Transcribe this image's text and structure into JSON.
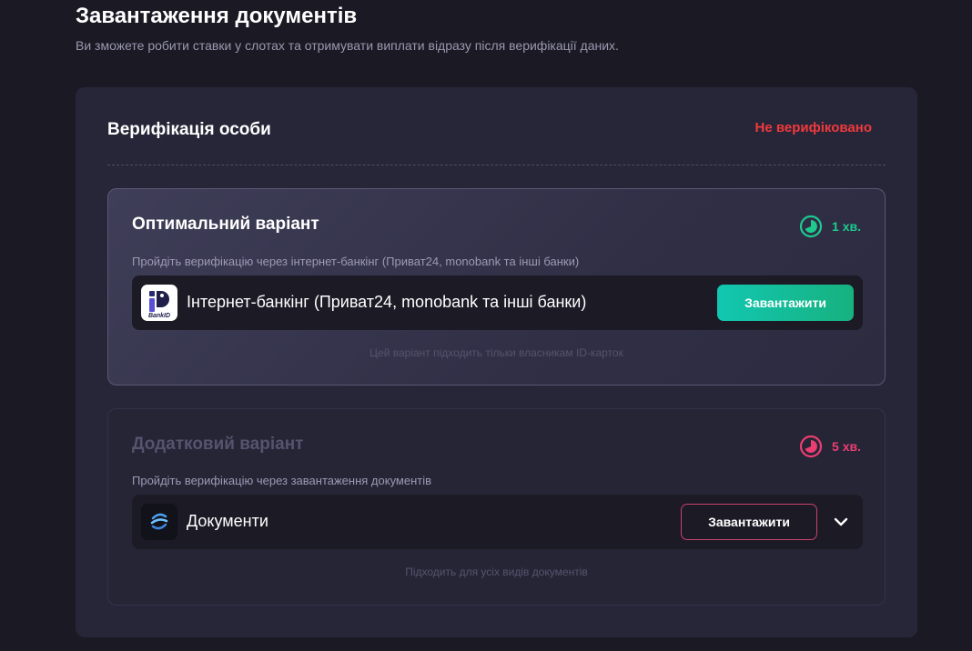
{
  "header": {
    "title": "Завантаження документів",
    "subtitle": "Ви зможете робити ставки у слотах та отримувати виплати відразу після верифікації даних."
  },
  "verification": {
    "title": "Верифікація особи",
    "status": "Не верифіковано",
    "status_color": "#f0393d"
  },
  "options": [
    {
      "title": "Оптимальний варіант",
      "time": "1 хв.",
      "time_color": "#1ec98e",
      "description": "Пройдіть верифікацію через інтернет-банкінг (Приват24, monobank та інші банки)",
      "method_label": "Інтернет-банкінг (Приват24, monobank та інші банки)",
      "icon": "bankid-logo-icon",
      "icon_text": "BankID",
      "button_label": "Завантажити",
      "note": "Цей варіант підходить тільки власникам ID-карток"
    },
    {
      "title": "Додатковий варіант",
      "time": "5 хв.",
      "time_color": "#ea3e73",
      "description": "Пройдіть верифікацію через завантаження документів",
      "method_label": "Документи",
      "icon": "documents-logo-icon",
      "button_label": "Завантажити",
      "note": "Підходить для усіх видів документів"
    }
  ],
  "colors": {
    "background": "#1b1a24",
    "panel": "#272638",
    "accent_green": "#12c7b1",
    "accent_pink": "#c8446c"
  }
}
